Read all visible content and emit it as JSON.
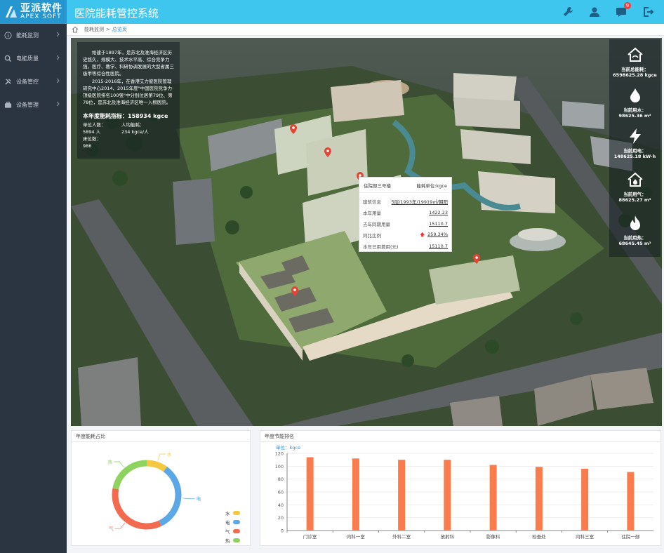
{
  "header": {
    "logo_cn": "亚派软件",
    "logo_en": "APEX SOFT",
    "title": "医院能耗管控系统",
    "notification_count": "9",
    "bg_color": "#3ec6ee",
    "logo_bg_color": "#2596cf"
  },
  "sidebar": {
    "items": [
      {
        "label": "能耗监测",
        "icon": "info-circle-icon"
      },
      {
        "label": "电能质量",
        "icon": "search-icon"
      },
      {
        "label": "设备管控",
        "icon": "wrench-icon"
      },
      {
        "label": "设备管理",
        "icon": "briefcase-icon"
      }
    ],
    "bg_color": "#2b3441"
  },
  "breadcrumb": {
    "root": "能耗监测",
    "separator": ">",
    "current": "总览页"
  },
  "info": {
    "para1": "始建于1897年，是苏北及淮海经济区历史悠久、规模大、技术水平高、综合竞争力强，医疗、教学、科研协调发展的大型省属三级甲等综合性医院。",
    "para2": "2015-2016年，在香港艾力彼医院管理研究中心2014、2015年度\"中国医院竞争力·顶级医院排名100强\"中分别位居第79位、第78位，是苏北及淮海经济区唯一入榜医院。",
    "target_label": "本年度能耗指标：",
    "target_value": "158934 kgce",
    "units_label": "单位人数：",
    "units_value": "5894 人",
    "per_capita_label": "人均能耗：",
    "per_capita_value": "234 kgce/人",
    "beds_label": "床位数：",
    "beds_value": "986"
  },
  "stats": [
    {
      "label": "当前总能耗：",
      "value": "6598625.28 kgce",
      "icon": "building-energy-icon"
    },
    {
      "label": "当前用水：",
      "value": "98625.36 m³",
      "icon": "water-drop-icon"
    },
    {
      "label": "当前用电：",
      "value": "148625.18 kW·h",
      "icon": "lightning-icon"
    },
    {
      "label": "当前用气：",
      "value": "88625.27 m³",
      "icon": "gas-flame-icon"
    },
    {
      "label": "当前用热：",
      "value": "68645.45 m³",
      "icon": "fire-icon"
    }
  ],
  "popup": {
    "title": "住院部三号楼",
    "unit": "能耗单位:kgce",
    "rows": [
      {
        "label": "建筑信息",
        "value": "5层/1993年/19919㎡/朝阳"
      },
      {
        "label": "本年用量",
        "value": "1422.23"
      },
      {
        "label": "去年同期用量",
        "value": "15110.7"
      },
      {
        "label": "同比比例",
        "value": "259.34%",
        "trend": "up"
      },
      {
        "label": "本年已用费用(元)",
        "value": "15110.7"
      }
    ]
  },
  "panels": {
    "donut_title": "年度能耗占比",
    "bar_title": "年度节能排名"
  },
  "chart_data": [
    {
      "type": "pie",
      "variant": "donut",
      "title": "年度能耗占比",
      "categories": [
        "水",
        "电",
        "气",
        "热"
      ],
      "values": [
        10,
        33,
        35,
        22
      ],
      "colors": [
        "#f5c842",
        "#5aa9e6",
        "#f26b4f",
        "#8ed25f"
      ],
      "legend": "bottom-right"
    },
    {
      "type": "bar",
      "title": "年度节能排名",
      "unit_label": "单位：kgce",
      "categories": [
        "门诊室",
        "内科一室",
        "外科二室",
        "放射科",
        "影像科",
        "检查处",
        "内科三室",
        "住院一部"
      ],
      "values": [
        114,
        112,
        110,
        110,
        102,
        99,
        96,
        91
      ],
      "ylim": [
        0,
        120
      ],
      "yticks": [
        0,
        20,
        40,
        60,
        80,
        100,
        120
      ],
      "bar_color": "#fa7c4d",
      "grid": true
    }
  ]
}
